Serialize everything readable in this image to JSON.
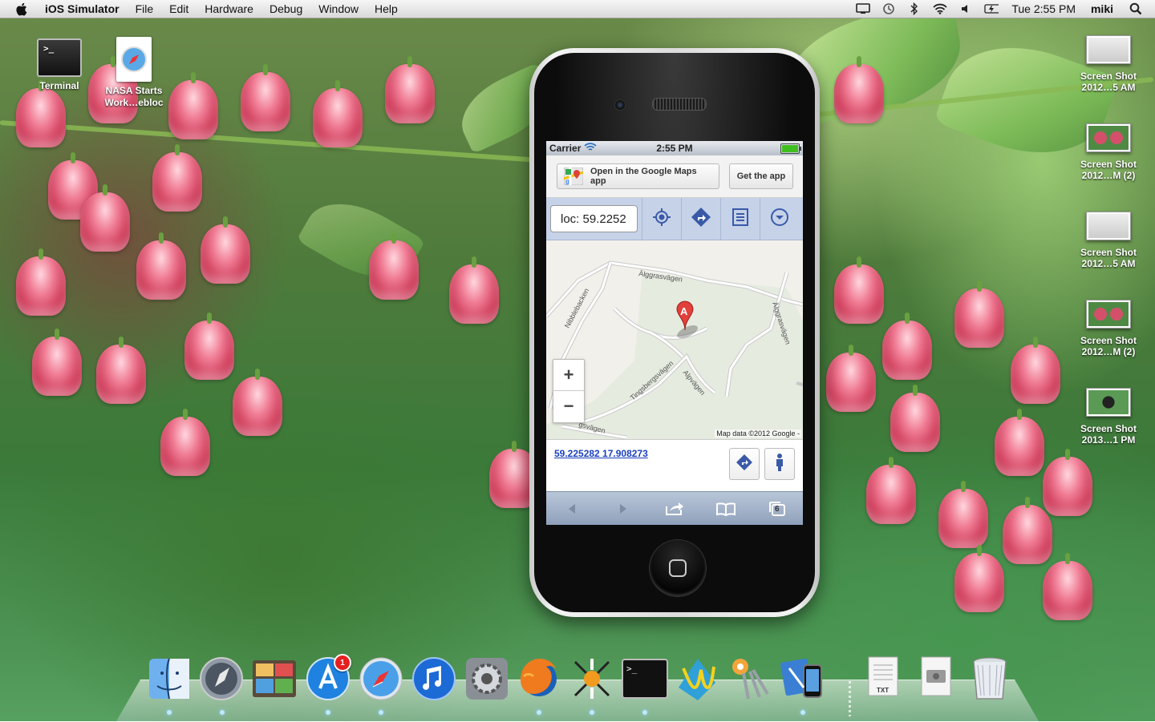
{
  "menubar": {
    "app_name": "iOS Simulator",
    "menus": [
      "File",
      "Edit",
      "Hardware",
      "Debug",
      "Window",
      "Help"
    ],
    "clock": "Tue 2:55 PM",
    "user": "miki"
  },
  "desktop": {
    "left_icons": [
      {
        "label": "Terminal"
      },
      {
        "label": "NASA Starts\nWork…ebloc"
      }
    ],
    "screenshots": [
      {
        "line1": "Screen Shot",
        "line2": "2012…5 AM"
      },
      {
        "line1": "Screen Shot",
        "line2": "2012…M (2)"
      },
      {
        "line1": "Screen Shot",
        "line2": "2012…5 AM"
      },
      {
        "line1": "Screen Shot",
        "line2": "2012…M (2)"
      },
      {
        "line1": "Screen Shot",
        "line2": "2013…1 PM"
      }
    ]
  },
  "phone": {
    "status": {
      "carrier": "Carrier",
      "time": "2:55 PM"
    },
    "promo": {
      "open_app": "Open in the Google Maps app",
      "get_app": "Get the app"
    },
    "search": {
      "value": "loc: 59.2252"
    },
    "map": {
      "attribution": "Map data ©2012 Google -",
      "streets": [
        "Älggrasvägen",
        "Nibblebacken",
        "Älggrasvägen",
        "Tingsbergsvägen",
        "Alpvägen",
        "gsvägen"
      ],
      "marker_label": "A"
    },
    "result": {
      "coords": "59.225282 17.908273"
    },
    "tabs_count": "6"
  },
  "dock": {
    "apps": [
      "Finder",
      "Launchpad",
      "Preview",
      "App Store",
      "Safari",
      "iTunes",
      "System Preferences",
      "Firefox",
      "Instruments",
      "Terminal",
      "TextWrangler",
      "Keychain Access",
      "Xcode",
      "Document",
      "Disk Utility",
      "Trash"
    ],
    "app_store_badge": "1",
    "txt_label": "TXT"
  }
}
